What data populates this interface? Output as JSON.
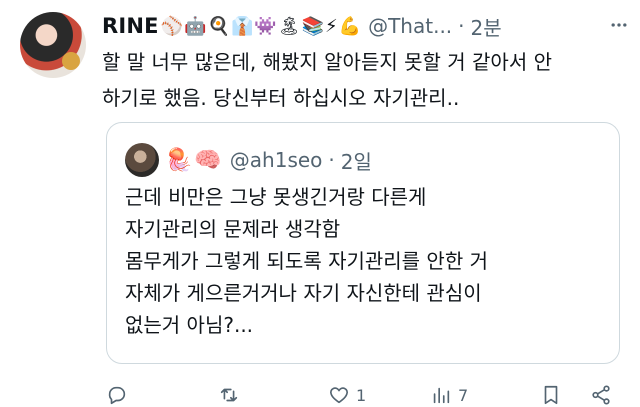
{
  "tweet": {
    "display_name": "RINE",
    "emojis": "⚾🤖🍳👔👾🏝📚⚡💪",
    "handle": "@That...",
    "separator": "·",
    "time": "2분",
    "text": "할 말 너무 많은데, 해봤지 알아듣지 못할 거 같아서 안\n하기로 했음. 당신부터 하십시오 자기관리.."
  },
  "quote": {
    "emojis": "🪼🧠",
    "handle": "@ah1seo",
    "separator": "·",
    "time": "2일",
    "text": "근데 비만은 그냥 못생긴거랑 다른게\n자기관리의 문제라 생각함\n몸무게가 그렇게 되도록 자기관리를 안한 거\n자체가 게으른거거나 자기 자신한테 관심이\n없는거 아님?..."
  },
  "actions": {
    "reply_count": "",
    "retweet_count": "",
    "like_count": "1",
    "views_count": "7"
  },
  "colors": {
    "text": "#0f1419",
    "secondary": "#536471",
    "border": "#cfd9de"
  }
}
